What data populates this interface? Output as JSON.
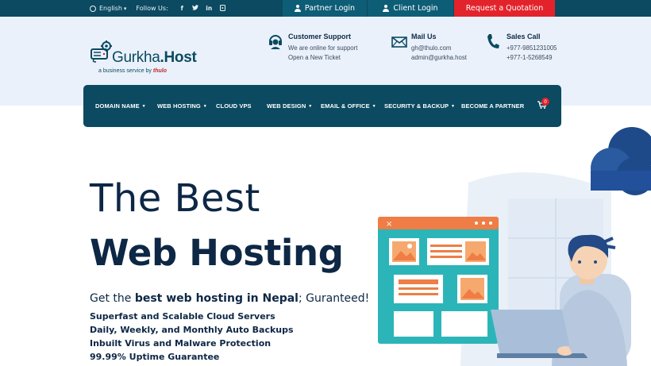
{
  "topbar": {
    "language": "English",
    "follow_label": "Follow Us:",
    "social": [
      "f",
      "t",
      "in",
      "yt"
    ],
    "partner_login": "Partner Login",
    "client_login": "Client Login",
    "quote_button": "Request a Quotation"
  },
  "logo": {
    "name_part1": "Gurkha",
    "name_part2": ".Host",
    "tagline_prefix": "a business service by",
    "tagline_brand": "thulo"
  },
  "contacts": {
    "support": {
      "title": "Customer Support",
      "line1": "We are online for support",
      "line2": "Open a New Ticket"
    },
    "mail": {
      "title": "Mail Us",
      "line1": "gh@thulo.com",
      "line2": "admin@gurkha.host"
    },
    "call": {
      "title": "Sales Call",
      "line1": "+977-9851231005",
      "line2": "+977-1-5268549"
    }
  },
  "nav": {
    "items": [
      {
        "label": "DOMAIN NAME",
        "dropdown": "▾"
      },
      {
        "label": "WEB HOSTING",
        "dropdown": "▾"
      },
      {
        "label": "CLOUD VPS",
        "dropdown": ""
      },
      {
        "label": "WEB DESIGN",
        "dropdown": "▾"
      },
      {
        "label": "EMAIL & OFFICE",
        "dropdown": "▾"
      },
      {
        "label": "SECURITY & BACKUP",
        "dropdown": "▾"
      },
      {
        "label": "BECOME A PARTNER",
        "dropdown": ""
      }
    ],
    "cart_count": "0"
  },
  "hero": {
    "line1": "The Best",
    "line2": "Web Hosting",
    "tagline_pre": "Get the ",
    "tagline_bold": "best web hosting in Nepal",
    "tagline_post": "; Guranteed!",
    "features": [
      "Superfast and Scalable Cloud Servers",
      "Daily, Weekly, and Monthly Auto Backups",
      "Inbuilt Virus and Malware Protection",
      "99.99% Uptime Guarantee"
    ]
  },
  "colors": {
    "primary": "#0b4a60",
    "accent_red": "#e3232b",
    "header_bg": "#eaf1fb",
    "heading": "#0d2745"
  }
}
